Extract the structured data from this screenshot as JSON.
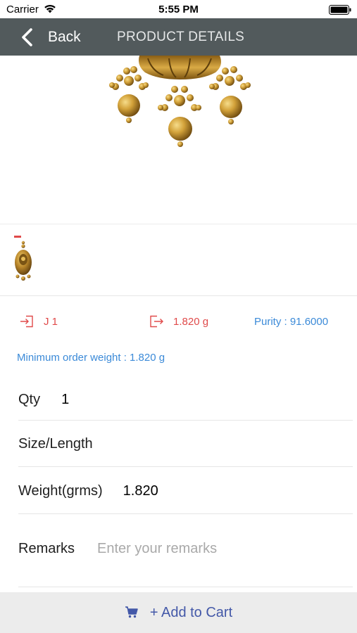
{
  "status_bar": {
    "carrier": "Carrier",
    "time": "5:55 PM"
  },
  "nav": {
    "back_label": "Back",
    "title": "PRODUCT DETAILS"
  },
  "product": {
    "code": "J 1",
    "weight": "1.820 g",
    "purity": "Purity : 91.6000",
    "min_order": "Minimum order weight : 1.820 g"
  },
  "form": {
    "qty_label": "Qty",
    "qty_value": "1",
    "size_label": "Size/Length",
    "size_value": "",
    "weight_label": "Weight(grms)",
    "weight_value": "1.820",
    "remarks_label": "Remarks",
    "remarks_placeholder": "Enter your remarks"
  },
  "cart": {
    "label": "+ Add to Cart"
  },
  "colors": {
    "nav_bg": "#525a5c",
    "accent_red": "#e04a4a",
    "accent_blue": "#3b8ad8",
    "cart_text": "#4358a8",
    "cart_bg": "#ececec",
    "gold": "#c9981f"
  },
  "icons": {
    "back": "chevron-left-icon",
    "code": "login-arrow-icon",
    "weight": "logout-arrow-icon",
    "cart": "cart-icon",
    "wifi": "wifi-icon",
    "battery": "battery-icon"
  }
}
